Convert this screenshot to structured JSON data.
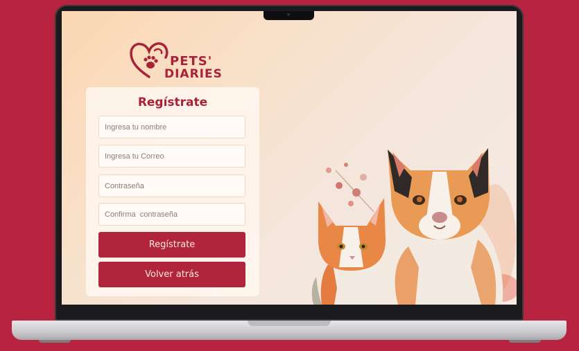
{
  "brand": {
    "line1": "PETS'",
    "line2": "DIARIES"
  },
  "form": {
    "title": "Regístrate",
    "name_placeholder": "Ingresa tu nombre",
    "email_placeholder": "Ingresa tu Correo",
    "password_placeholder": "Contraseña",
    "confirm_placeholder": "Confirma  contraseña",
    "register_label": "Regístrate",
    "back_label": "Volver atrás"
  },
  "colors": {
    "brand": "#b0243c",
    "background": "#b8243f"
  },
  "icons": [
    "heart-paw-logo-icon",
    "webcam-icon"
  ]
}
